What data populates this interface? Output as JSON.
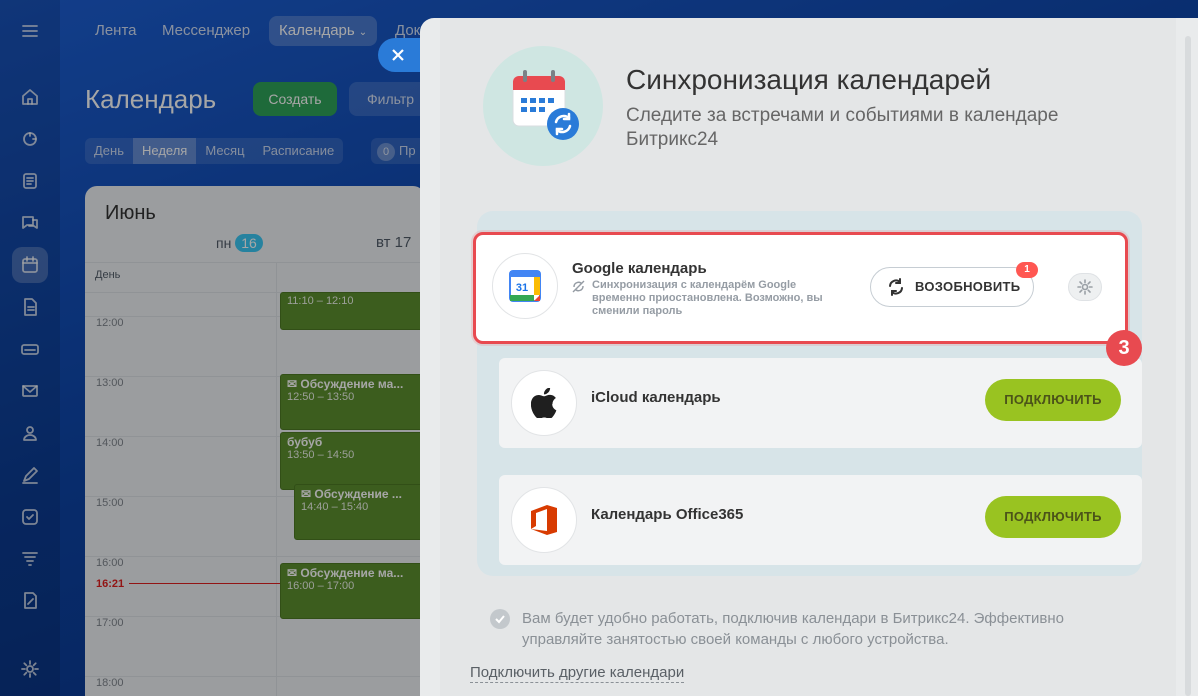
{
  "nav": {
    "items": [
      "Лента",
      "Мессенджер",
      "Календарь",
      "Док"
    ],
    "active_index": 2
  },
  "calendar": {
    "title": "Календарь",
    "create_label": "Создать",
    "filter_label": "Фильтр",
    "views": [
      "День",
      "Неделя",
      "Месяц",
      "Расписание"
    ],
    "active_view": "Неделя",
    "requests_count": "0",
    "requests_label": "Пр",
    "month": "Июнь",
    "mon_label": "пн",
    "mon_day": "16",
    "tue_label": "вт 17",
    "allday_label": "День",
    "hours": [
      "12:00",
      "13:00",
      "14:00",
      "15:00",
      "16:00",
      "17:00",
      "18:00"
    ],
    "now_time": "16:21",
    "events": [
      {
        "title": "",
        "time": "11:10 – 12:10"
      },
      {
        "title": "Обсуждение ма...",
        "time": "12:50 – 13:50"
      },
      {
        "title": "бубуб",
        "time": "13:50 – 14:50"
      },
      {
        "title": "Обсуждение ...",
        "time": "14:40 – 15:40"
      },
      {
        "title": "Обсуждение ма...",
        "time": "16:00 – 17:00"
      }
    ]
  },
  "panel": {
    "title": "Синхронизация календарей",
    "subtitle": "Следите за встречами и событиями в календаре Битрикс24",
    "google": {
      "name": "Google календарь",
      "warning": "Синхронизация с календарём Google временно приостановлена. Возможно, вы сменили пароль",
      "renew_label": "ВОЗОБНОВИТЬ",
      "badge": "1",
      "icon_text": "31"
    },
    "icloud": {
      "name": "iCloud календарь",
      "connect_label": "ПОДКЛЮЧИТЬ"
    },
    "office": {
      "name": "Календарь Office365",
      "connect_label": "ПОДКЛЮЧИТЬ"
    },
    "note": "Вам будет удобно работать, подключив календари в Битрикс24. Эффективно управляйте занятостью своей команды с любого устройства.",
    "other_link": "Подключить другие календари",
    "step_marker": "3"
  },
  "colors": {
    "accent_blue": "#2a7bd8",
    "connect_green": "#99c321",
    "event_green": "#5c8f2e",
    "highlight_red": "#e84a50"
  }
}
